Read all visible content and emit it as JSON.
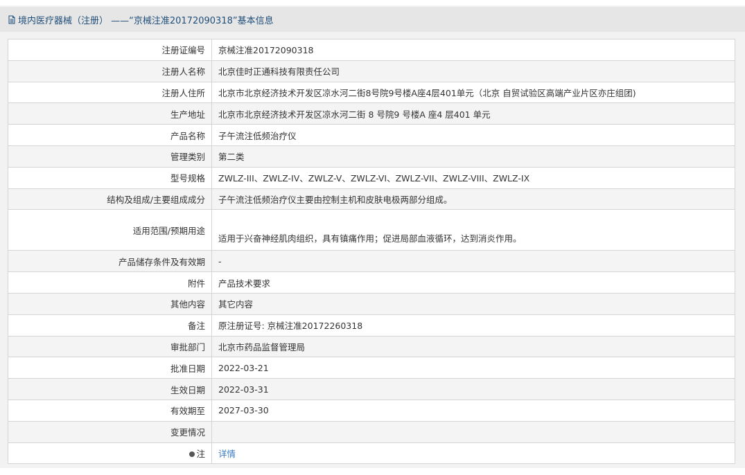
{
  "header": {
    "icon": "document-icon",
    "title": "境内医疗器械（注册） ——“京械注准20172090318”基本信息"
  },
  "rows": [
    {
      "label": "注册证编号",
      "value": "京械注准20172090318"
    },
    {
      "label": "注册人名称",
      "value": "北京佳时正通科技有限责任公司"
    },
    {
      "label": "注册人住所",
      "value": "北京市北京经济技术开发区凉水河二街8号院9号楼A座4层401单元（北京 自贸试验区高端产业片区亦庄组团)"
    },
    {
      "label": "生产地址",
      "value": "北京市北京经济技术开发区凉水河二街 8 号院9 号楼A 座4 层401 单元"
    },
    {
      "label": "产品名称",
      "value": "子午流注低频治疗仪"
    },
    {
      "label": "管理类别",
      "value": "第二类"
    },
    {
      "label": "型号规格",
      "value": "ZWLZ-III、ZWLZ-IV、ZWLZ-V、ZWLZ-VI、ZWLZ-VII、ZWLZ-VIII、ZWLZ-IX"
    },
    {
      "label": "结构及组成/主要组成成分",
      "value": "子午流注低频治疗仪主要由控制主机和皮肤电极两部分组成。"
    },
    {
      "label": "适用范围/预期用途",
      "value": "适用于兴奋神经肌肉组织，具有镇痛作用；促进局部血液循环，达到消炎作用。"
    },
    {
      "label": "产品储存条件及有效期",
      "value": "-"
    },
    {
      "label": "附件",
      "value": "产品技术要求"
    },
    {
      "label": "其他内容",
      "value": "其它内容"
    },
    {
      "label": "备注",
      "value": "原注册证号: 京械注准20172260318"
    },
    {
      "label": "审批部门",
      "value": "北京市药品监督管理局"
    },
    {
      "label": "批准日期",
      "value": "2022-03-21"
    },
    {
      "label": "生效日期",
      "value": "2022-03-31"
    },
    {
      "label": "有效期至",
      "value": "2027-03-30"
    },
    {
      "label": "变更情况",
      "value": ""
    }
  ],
  "note_row": {
    "icon": "dot-icon",
    "label": "注",
    "link": "详情"
  }
}
